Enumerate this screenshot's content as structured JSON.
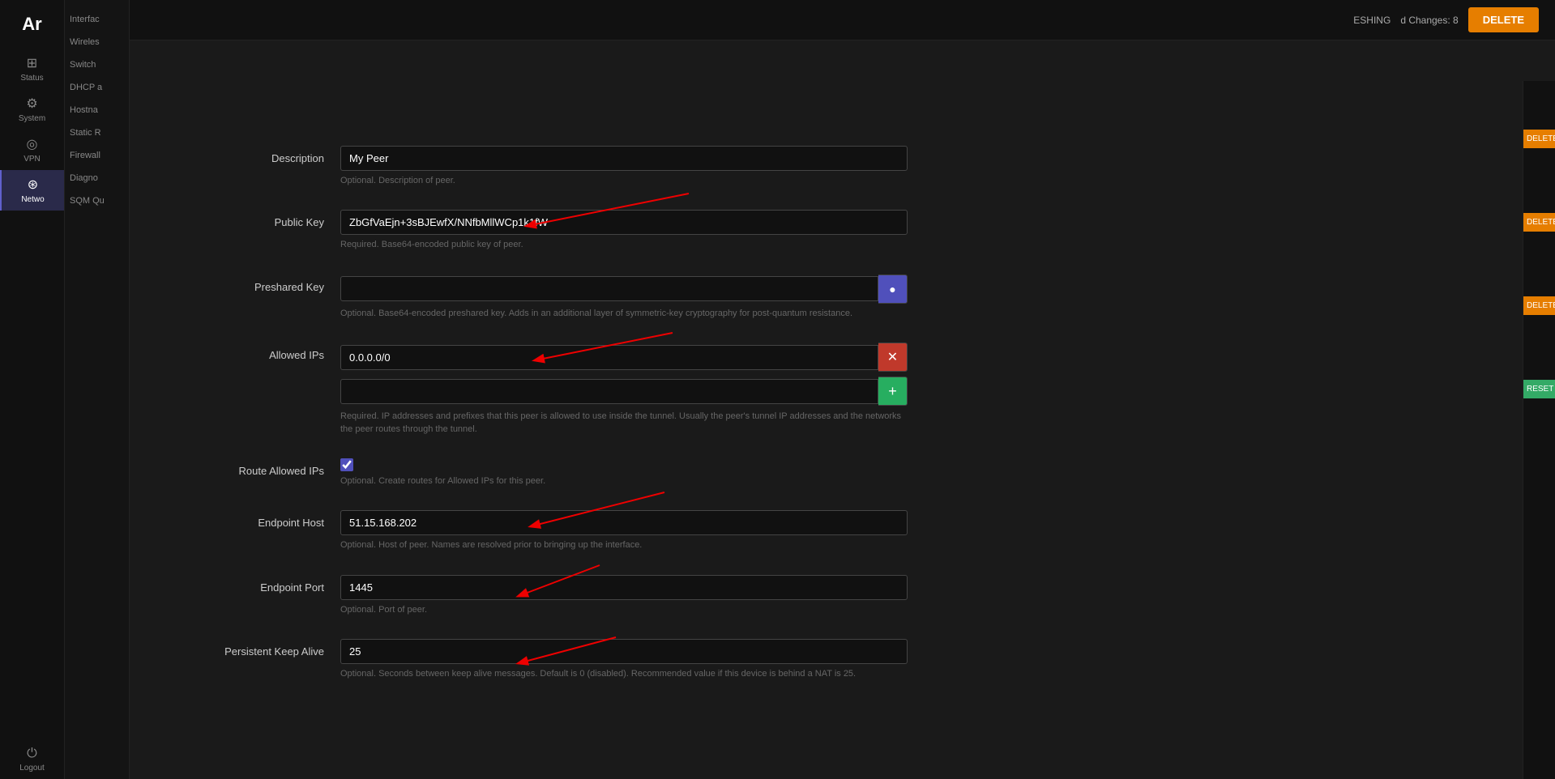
{
  "app": {
    "logo": "Ar",
    "pending_label": "ESHING",
    "changes_label": "d Changes: 8",
    "delete_button": "DELETE"
  },
  "sidebar": {
    "items": [
      {
        "id": "status",
        "label": "Status",
        "icon": "⊞"
      },
      {
        "id": "system",
        "label": "System",
        "icon": "⚙"
      },
      {
        "id": "vpn",
        "label": "VPN",
        "icon": "◎"
      },
      {
        "id": "network",
        "label": "Netwo",
        "icon": "⊛",
        "active": true
      }
    ],
    "logout": {
      "label": "Logout",
      "icon": "⏻"
    }
  },
  "subnav": {
    "items": [
      {
        "id": "interfaces",
        "label": "Interfac"
      },
      {
        "id": "wireless",
        "label": "Wireles"
      },
      {
        "id": "switch",
        "label": "Switch",
        "active": false
      },
      {
        "id": "dhcp",
        "label": "DHCP a"
      },
      {
        "id": "hostname",
        "label": "Hostna"
      },
      {
        "id": "static",
        "label": "Static R",
        "active": false
      },
      {
        "id": "firewall",
        "label": "Firewall",
        "active": false
      },
      {
        "id": "diagnostics",
        "label": "Diagno"
      },
      {
        "id": "sqm",
        "label": "SQM Qu"
      }
    ]
  },
  "form": {
    "description": {
      "label": "Description",
      "value": "My Peer",
      "hint": "Optional. Description of peer."
    },
    "public_key": {
      "label": "Public Key",
      "value": "ZbGfVaEjn+3sBJEwfX/NNfbMllWCp1k1fW",
      "hint": "Required. Base64-encoded public key of peer."
    },
    "preshared_key": {
      "label": "Preshared Key",
      "value": "",
      "hint": "Optional. Base64-encoded preshared key. Adds in an additional layer of symmetric-key cryptography for post-quantum resistance.",
      "eye_icon": "●"
    },
    "allowed_ips": {
      "label": "Allowed IPs",
      "existing_value": "0.0.0.0/0",
      "new_value": "",
      "hint": "Required. IP addresses and prefixes that this peer is allowed to use inside the tunnel. Usually the peer's tunnel IP addresses and the networks the peer routes through the tunnel.",
      "remove_icon": "✕",
      "add_icon": "+"
    },
    "route_allowed_ips": {
      "label": "Route Allowed IPs",
      "checked": true,
      "hint": "Optional. Create routes for Allowed IPs for this peer."
    },
    "endpoint_host": {
      "label": "Endpoint Host",
      "value": "51.15.168.202",
      "hint": "Optional. Host of peer. Names are resolved prior to bringing up the interface."
    },
    "endpoint_port": {
      "label": "Endpoint Port",
      "value": "1445",
      "hint": "Optional. Port of peer."
    },
    "persistent_keep_alive": {
      "label": "Persistent Keep Alive",
      "value": "25",
      "hint": "Optional. Seconds between keep alive messages. Default is 0 (disabled). Recommended value if this device is behind a NAT is 25."
    }
  },
  "right_panel": {
    "buttons": [
      "DELETE",
      "DELETE",
      "DELETE",
      "RESET"
    ]
  }
}
